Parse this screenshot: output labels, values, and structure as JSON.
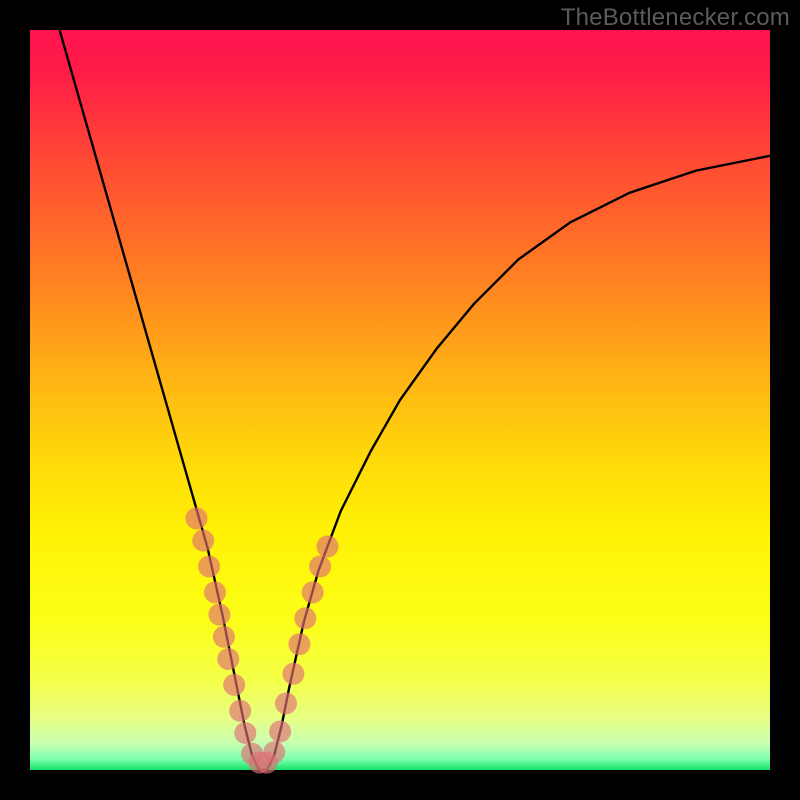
{
  "watermark": "TheBottlenecker.com",
  "chart_data": {
    "type": "line",
    "title": "",
    "xlabel": "",
    "ylabel": "",
    "xlim": [
      0,
      100
    ],
    "ylim": [
      0,
      100
    ],
    "grid": false,
    "legend": false,
    "background_gradient": {
      "stops": [
        {
          "offset": 0.0,
          "color": "#ff1450"
        },
        {
          "offset": 0.06,
          "color": "#ff1d46"
        },
        {
          "offset": 0.18,
          "color": "#ff4b34"
        },
        {
          "offset": 0.32,
          "color": "#ff7b23"
        },
        {
          "offset": 0.46,
          "color": "#ffb015"
        },
        {
          "offset": 0.58,
          "color": "#ffd90a"
        },
        {
          "offset": 0.68,
          "color": "#fff205"
        },
        {
          "offset": 0.8,
          "color": "#fcff18"
        },
        {
          "offset": 0.88,
          "color": "#f4ff4a"
        },
        {
          "offset": 0.93,
          "color": "#e8ff84"
        },
        {
          "offset": 0.965,
          "color": "#c6ffb3"
        },
        {
          "offset": 0.985,
          "color": "#7fffae"
        },
        {
          "offset": 1.0,
          "color": "#17e26a"
        }
      ]
    },
    "frame": {
      "color": "#000000",
      "thickness_px": 30
    },
    "series": [
      {
        "name": "bottleneck-curve",
        "stroke": "#000000",
        "x": [
          4,
          6,
          8,
          10,
          12,
          14,
          16,
          18,
          20,
          22,
          24,
          26,
          27,
          28,
          29,
          30,
          31,
          32,
          33,
          34,
          35,
          37,
          39,
          42,
          46,
          50,
          55,
          60,
          66,
          73,
          81,
          90,
          100
        ],
        "y": [
          100,
          93,
          86,
          79,
          72,
          65,
          58,
          51,
          44,
          37,
          30,
          21,
          16,
          11,
          6,
          2,
          0,
          0,
          2,
          6,
          11,
          20,
          27,
          35,
          43,
          50,
          57,
          63,
          69,
          74,
          78,
          81,
          83
        ]
      }
    ],
    "markers": {
      "name": "dot-cluster",
      "fill": "#e06f74",
      "fill_opacity": 0.65,
      "radius_px": 11,
      "points_xy": [
        [
          22.5,
          34
        ],
        [
          23.4,
          31
        ],
        [
          24.2,
          27.5
        ],
        [
          25.0,
          24
        ],
        [
          25.6,
          21
        ],
        [
          26.2,
          18
        ],
        [
          26.8,
          15
        ],
        [
          27.6,
          11.5
        ],
        [
          28.4,
          8
        ],
        [
          29.1,
          5
        ],
        [
          30.0,
          2.2
        ],
        [
          31.0,
          1.0
        ],
        [
          32.0,
          1.0
        ],
        [
          33.0,
          2.4
        ],
        [
          33.8,
          5.2
        ],
        [
          34.6,
          9
        ],
        [
          35.6,
          13
        ],
        [
          36.4,
          17
        ],
        [
          37.2,
          20.5
        ],
        [
          38.2,
          24
        ],
        [
          39.2,
          27.5
        ],
        [
          40.2,
          30.2
        ]
      ]
    }
  }
}
